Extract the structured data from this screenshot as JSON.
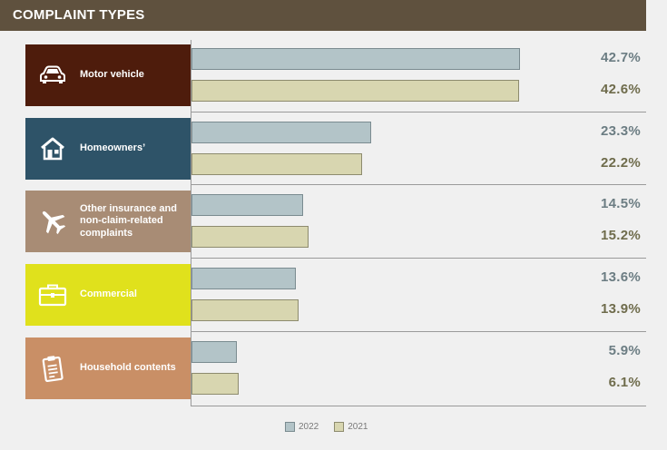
{
  "header": {
    "title": "COMPLAINT TYPES"
  },
  "chart_data": {
    "type": "bar",
    "orientation": "horizontal",
    "categories": [
      "Motor vehicle",
      "Homeowners’",
      "Other insurance and non-claim-related complaints",
      "Commercial",
      "Household contents"
    ],
    "series": [
      {
        "name": "2022",
        "values": [
          42.7,
          23.3,
          14.5,
          13.6,
          5.9
        ],
        "labels": [
          "42.7%",
          "23.3%",
          "14.5%",
          "13.6%",
          "5.9%"
        ],
        "color": "#b3c4c8"
      },
      {
        "name": "2021",
        "values": [
          42.6,
          22.2,
          15.2,
          13.9,
          6.1
        ],
        "labels": [
          "42.6%",
          "22.2%",
          "15.2%",
          "13.9%",
          "6.1%"
        ],
        "color": "#d8d6b0"
      }
    ],
    "xlim": [
      0,
      50
    ],
    "grid": false,
    "legend_position": "bottom-center"
  },
  "category_colors": [
    "#4e1c0c",
    "#2e5368",
    "#a88c75",
    "#e0e11c",
    "#c98f66"
  ],
  "category_icons": [
    "car-icon",
    "house-icon",
    "airplane-icon",
    "briefcase-icon",
    "clipboard-icon"
  ],
  "legend": {
    "items": [
      "2022",
      "2021"
    ]
  }
}
